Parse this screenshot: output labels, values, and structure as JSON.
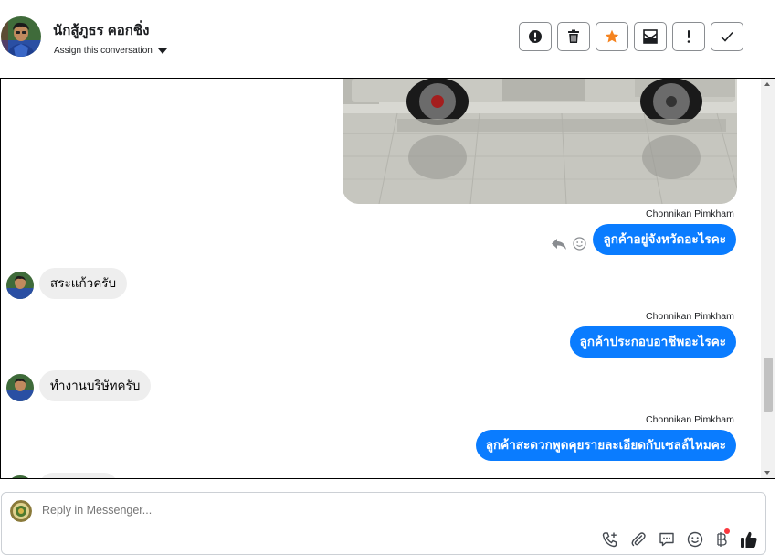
{
  "header": {
    "contact_name": "นักสู้ภูธร คอกชิ่ง",
    "assign_label": "Assign this conversation",
    "actions": [
      {
        "name": "spam-button",
        "icon": "exclamation-circle-icon"
      },
      {
        "name": "delete-button",
        "icon": "trash-icon"
      },
      {
        "name": "star-button",
        "icon": "star-icon",
        "color": "#f5831f"
      },
      {
        "name": "mark-unread-button",
        "icon": "envelope-icon"
      },
      {
        "name": "follow-up-button",
        "icon": "exclamation-icon"
      },
      {
        "name": "done-button",
        "icon": "check-icon"
      }
    ]
  },
  "thread": {
    "messages": [
      {
        "direction": "out",
        "sender": "Chonnikan Pimkham",
        "text": "ลูกค้าอยู่จังหวัดอะไรคะ"
      },
      {
        "direction": "in",
        "text": "สระแก้วครับ"
      },
      {
        "direction": "out",
        "sender": "Chonnikan Pimkham",
        "text": "ลูกค้าประกอบอาชีพอะไรคะ"
      },
      {
        "direction": "in",
        "text": "ทำงานบริษัทครับ"
      },
      {
        "direction": "out",
        "sender": "Chonnikan Pimkham",
        "text": "ลูกค้าสะดวกพูดคุยรายละเอียดกับเซลล์ไหมคะ"
      }
    ]
  },
  "composer": {
    "placeholder": "Reply in Messenger...",
    "tools": [
      "phone-add-icon",
      "paperclip-icon",
      "saved-reply-icon",
      "emoji-icon",
      "baht-icon",
      "thumbs-up-icon"
    ]
  },
  "colors": {
    "accent": "#0a7cff",
    "incoming_bubble": "#eeeeee",
    "star": "#f5831f"
  }
}
